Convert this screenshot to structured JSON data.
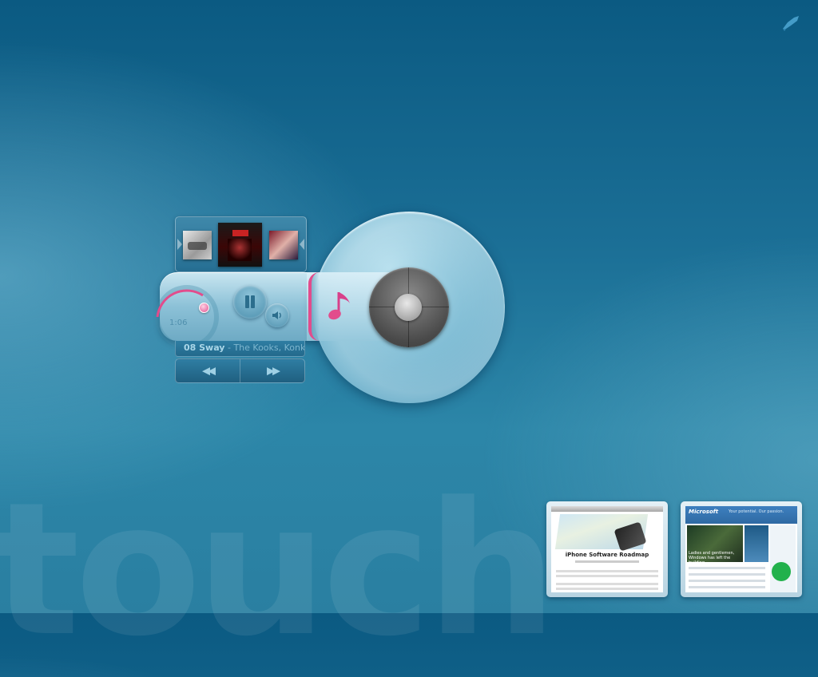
{
  "background": {
    "watermark_text": "touch",
    "colors": {
      "top": "#0b5a82",
      "bottom": "#2a7fa1",
      "accent_pink": "#e24c8c"
    }
  },
  "top_right_icon": {
    "icon": "pen-brush-icon"
  },
  "player": {
    "album_strip": {
      "covers": [
        {
          "icon": "album-cover-icon"
        },
        {
          "icon": "album-cover-icon"
        },
        {
          "icon": "album-cover-icon"
        }
      ]
    },
    "time_elapsed": "1:06",
    "now_playing": {
      "title": "08 Sway",
      "separator": " - ",
      "artist": "The Kooks, Konk"
    },
    "controls": {
      "pause_icon": "pause-icon",
      "volume_icon": "speaker-icon",
      "rewind_icon": "rewind-icon",
      "forward_icon": "fast-forward-icon",
      "rewind_label": "◀◀",
      "forward_label": "▶▶"
    },
    "disc": {
      "icon": "music-note-icon"
    }
  },
  "thumbnails": [
    {
      "headline": "iPhone Software Roadmap"
    },
    {
      "logo": "Microsoft",
      "tagline": "Your potential. Our passion.",
      "hero_text": "Ladies and gentlemen, Windows has left the building."
    }
  ]
}
